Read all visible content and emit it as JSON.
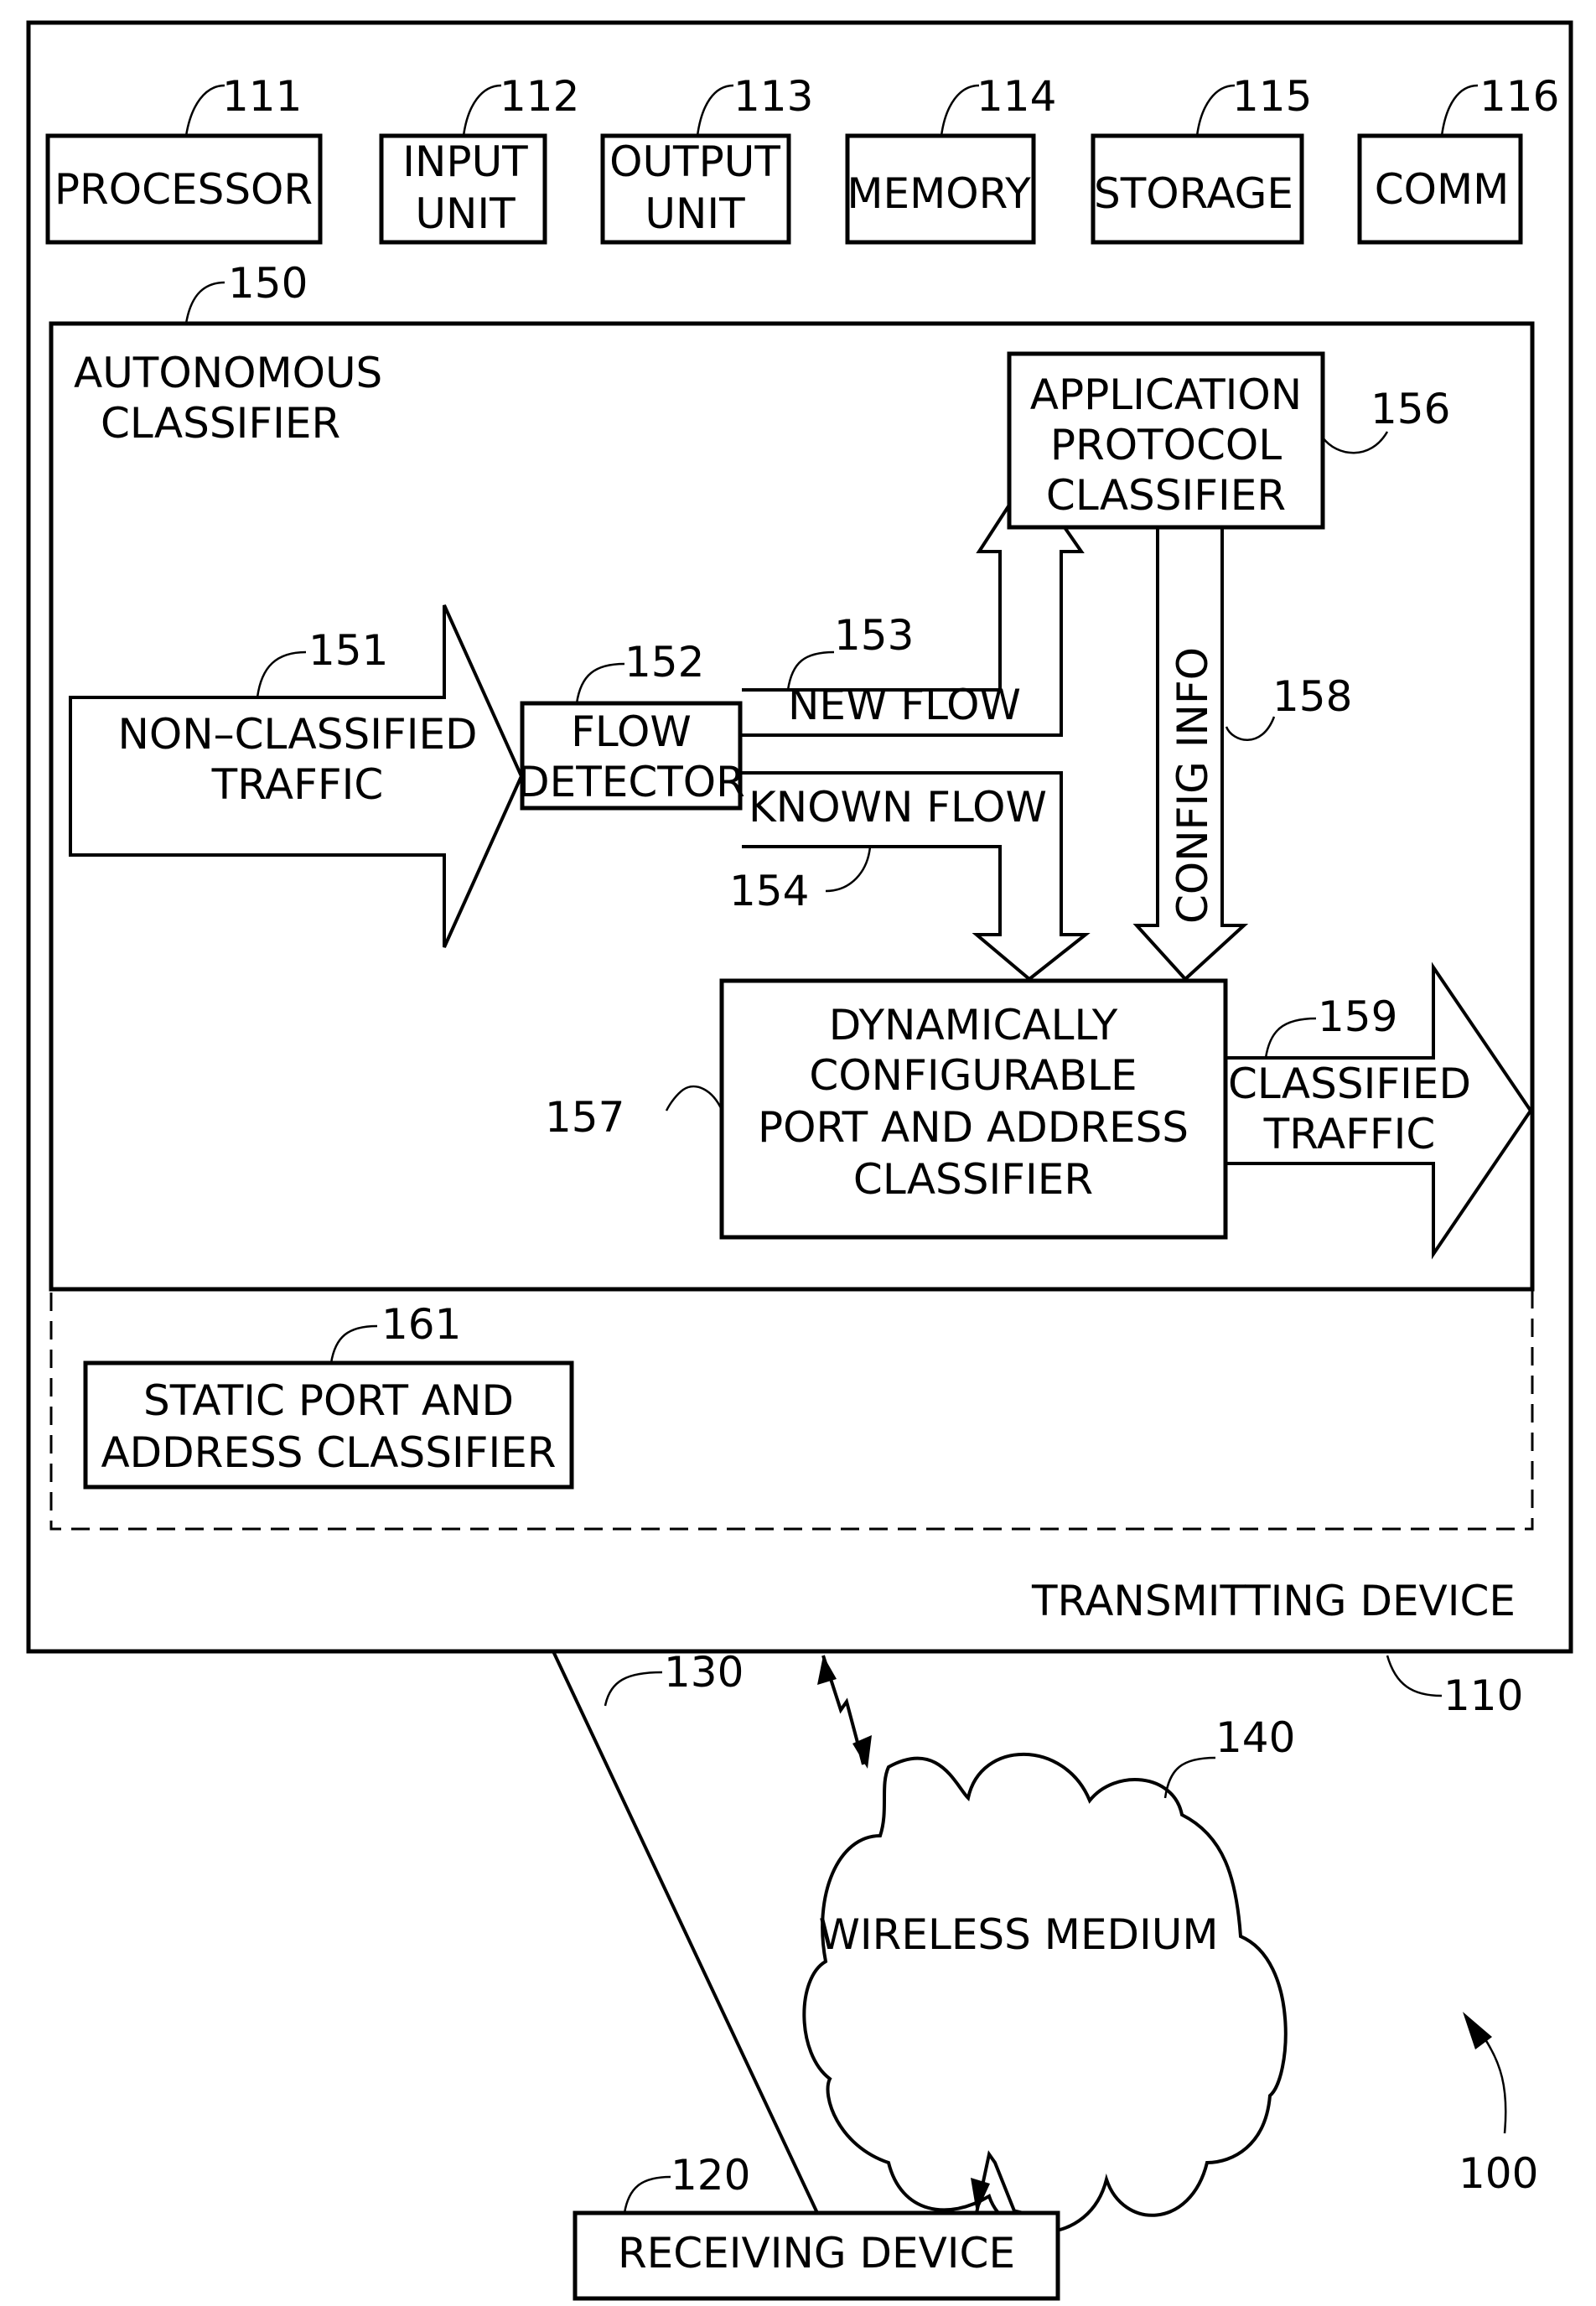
{
  "figure": {
    "ref": "100",
    "transmitting_device": {
      "ref": "110",
      "label": "TRANSMITTING DEVICE"
    },
    "components": [
      {
        "ref": "111",
        "lines": [
          "PROCESSOR"
        ]
      },
      {
        "ref": "112",
        "lines": [
          "INPUT",
          "UNIT"
        ]
      },
      {
        "ref": "113",
        "lines": [
          "OUTPUT",
          "UNIT"
        ]
      },
      {
        "ref": "114",
        "lines": [
          "MEMORY"
        ]
      },
      {
        "ref": "115",
        "lines": [
          "STORAGE"
        ]
      },
      {
        "ref": "116",
        "lines": [
          "COMM"
        ]
      }
    ],
    "autonomous_classifier": {
      "ref": "150",
      "lines": [
        "AUTONOMOUS",
        "CLASSIFIER"
      ],
      "non_classified": {
        "ref": "151",
        "lines": [
          "NON–CLASSIFIED",
          "TRAFFIC"
        ]
      },
      "flow_detector": {
        "ref": "152",
        "lines": [
          "FLOW",
          "DETECTOR"
        ]
      },
      "new_flow": {
        "ref": "153",
        "label": "NEW  FLOW"
      },
      "known_flow": {
        "ref": "154",
        "label": "KNOWN  FLOW"
      },
      "app_protocol": {
        "ref": "156",
        "lines": [
          "APPLICATION",
          "PROTOCOL",
          "CLASSIFIER"
        ]
      },
      "dynamic_classifier": {
        "ref": "157",
        "lines": [
          "DYNAMICALLY",
          "CONFIGURABLE",
          "PORT  AND  ADDRESS",
          "CLASSIFIER"
        ]
      },
      "config_info": {
        "ref": "158",
        "label": "CONFIG  INFO"
      },
      "classified": {
        "ref": "159",
        "lines": [
          "CLASSIFIED",
          "TRAFFIC"
        ]
      }
    },
    "static_classifier": {
      "ref": "161",
      "lines": [
        "STATIC  PORT  AND",
        "ADDRESS  CLASSIFIER"
      ]
    },
    "receiving_device": {
      "ref": "120",
      "label": "RECEIVING  DEVICE"
    },
    "link": {
      "ref": "130"
    },
    "wireless_medium": {
      "ref": "140",
      "label": "WIRELESS  MEDIUM"
    }
  }
}
